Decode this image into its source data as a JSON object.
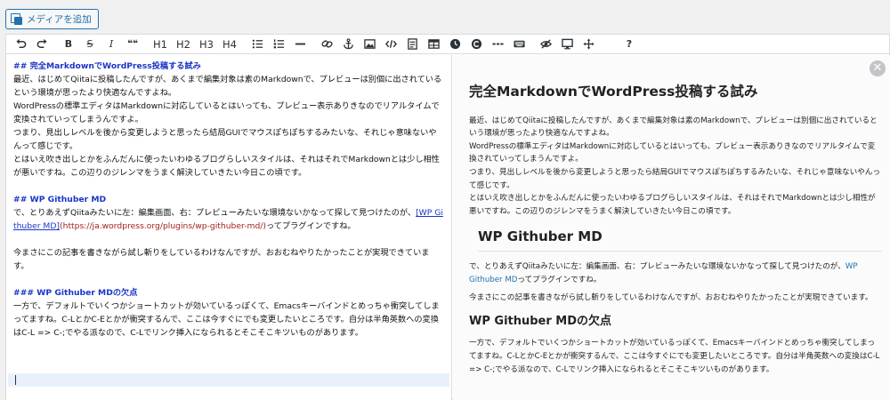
{
  "media_button": {
    "label": "メディアを追加"
  },
  "toolbar": {
    "undo": "undo",
    "redo": "redo",
    "bold": "B",
    "strike": "S",
    "italic": "I",
    "quote": "❝❝",
    "h1": "H1",
    "h2": "H2",
    "h3": "H3",
    "h4": "H4",
    "help": "?"
  },
  "editor": {
    "h2_1": "## 完全MarkdownでWordPress投稿する試み",
    "p1": "最近、はじめてQiitaに投稿したんですが、あくまで編集対象は素のMarkdownで、プレビューは別個に出されているという環境が思ったより快適なんですよね。",
    "p2": "WordPressの標準エディタはMarkdownに対応しているとはいっても、プレビュー表示ありきなのでリアルタイムで変換されていってしまうんですよ。",
    "p3": "つまり、見出しレベルを後から変更しようと思ったら結局GUIでマウスぽちぽちするみたいな、それじゃ意味ないやんって感じです。",
    "p4": "とはいえ吹き出しとかをふんだんに使ったいわゆるブログらしいスタイルは、それはそれでMarkdownとは少し相性が悪いですね。この辺りのジレンマをうまく解決していきたい今日この頃です。",
    "h2_2": "## WP Githuber MD",
    "p5_a": "で、とりあえずQiitaみたいに左：編集画面、右：プレビューみたいな環境ないかなって探して見つけたのが、",
    "p5_link": "[WP Githuber MD]",
    "p5_url": "(https://ja.wordpress.org/plugins/wp-githuber-md/)",
    "p5_b": "ってプラグインですね。",
    "p6": "今まさにこの記事を書きながら試し斬りをしているわけなんですが、おおむねやりたかったことが実現できています。",
    "h3_1": "### WP Githuber MDの欠点",
    "p7": "一方で、デフォルトでいくつかショートカットが効いているっぽくて、Emacsキーバインドとめっちゃ衝突してしまってますね。C-LとかC-Eとかが衝突するんで、ここは今すぐにでも変更したいところです。自分は半角英数への変換はC-L => C-;でやる派なので、C-Lでリンク挿入になられるとそこそこキツいものがあります。"
  },
  "preview": {
    "h1": "完全MarkdownでWordPress投稿する試み",
    "p1": "最近、はじめてQiitaに投稿したんですが、あくまで編集対象は素のMarkdownで、プレビューは別個に出されているという環境が思ったより快適なんですよね。",
    "p2": "WordPressの標準エディタはMarkdownに対応しているとはいっても、プレビュー表示ありきなのでリアルタイムで変換されていってしまうんですよ。",
    "p3": "つまり、見出しレベルを後から変更しようと思ったら結局GUIでマウスぽちぽちするみたいな、それじゃ意味ないやんって感じです。",
    "p4": "とはいえ吹き出しとかをふんだんに使ったいわゆるブログらしいスタイルは、それはそれでMarkdownとは少し相性が悪いですね。この辺りのジレンマをうまく解決していきたい今日この頃です。",
    "h2": "WP Githuber MD",
    "p5_a": "で、とりあえずQiitaみたいに左：編集画面、右：プレビューみたいな環境ないかなって探して見つけたのが、",
    "p5_link": "WP Githuber MD",
    "p5_b": "ってプラグインですね。",
    "p6": "今まさにこの記事を書きながら試し斬りをしているわけなんですが、おおむねやりたかったことが実現できています。",
    "h3": "WP Githuber MDの欠点",
    "p7": "一方で、デフォルトでいくつかショートカットが効いているっぽくて、Emacsキーバインドとめっちゃ衝突してしまってますね。C-LとかC-Eとかが衝突するんで、ここは今すぐにでも変更したいところです。自分は半角英数への変換はC-L => C-;でやる派なので、C-Lでリンク挿入になられるとそこそこキツいものがあります。",
    "close": "✕"
  },
  "colors": {
    "accent": "#2271b1",
    "md_heading": "#1a35c8",
    "md_url": "#a32020"
  }
}
